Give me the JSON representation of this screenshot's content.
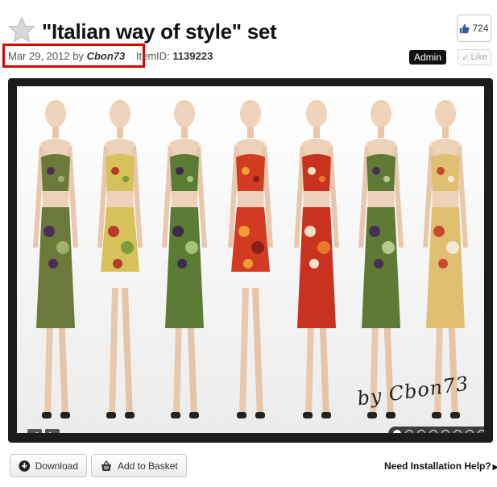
{
  "item": {
    "title": "\"Italian way of style\" set",
    "date": "Mar 29, 2012",
    "by_label": "by",
    "author": "Cbon73",
    "itemid_label": "ItemID:",
    "itemid": "1139223"
  },
  "social": {
    "like_count": "724",
    "like_label": "Like",
    "admin_label": "Admin"
  },
  "gallery": {
    "signature": "by Cbon73",
    "slide_count": 8,
    "active_slide": 1,
    "prev_label": "◀",
    "next_label": "▶"
  },
  "actions": {
    "download_label": "Download",
    "basket_label": "Add to Basket",
    "help_label": "Need Installation Help?"
  },
  "icons": {
    "favorite": "star-icon",
    "like": "thumbs-up-icon",
    "download": "download-icon",
    "basket": "basket-icon"
  },
  "colors": {
    "highlight": "#e00000",
    "admin_bg": "#111111",
    "gallery_bg": "#1c1c1c"
  }
}
